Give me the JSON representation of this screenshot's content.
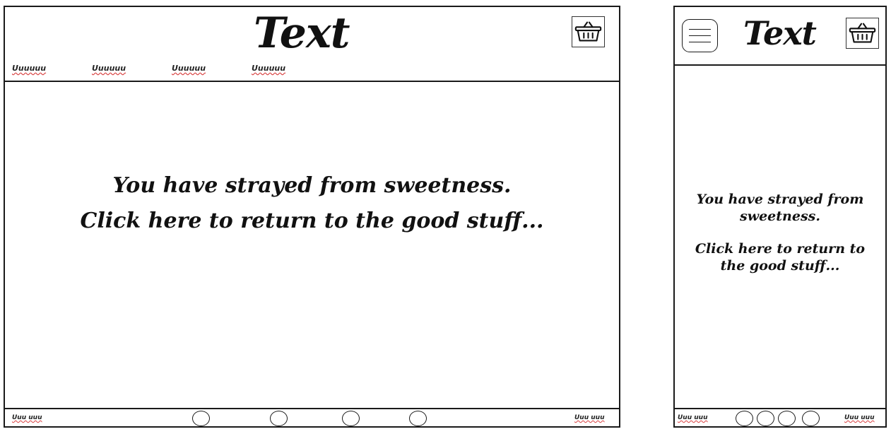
{
  "desktop": {
    "header": {
      "title": "Text",
      "nav_items": [
        "Uuuuuu",
        "Uuuuuu",
        "Uuuuuu",
        "Uuuuuu"
      ],
      "cart_icon": "basket-icon"
    },
    "message": {
      "line1": "You have strayed from sweetness.",
      "line2": "Click here to return to the good stuff..."
    },
    "footer": {
      "left_text": "Uuu uuu",
      "right_text": "Uuu uuu",
      "dot_count": 4
    }
  },
  "mobile": {
    "header": {
      "title": "Text",
      "menu_icon": "hamburger-menu-icon",
      "cart_icon": "basket-icon"
    },
    "message": {
      "line1": "You have strayed from sweetness.",
      "line2": "Click here to return to the good stuff..."
    },
    "footer": {
      "left_text": "Uuu uuu",
      "right_text": "Uuu uuu",
      "dot_count": 4
    }
  }
}
